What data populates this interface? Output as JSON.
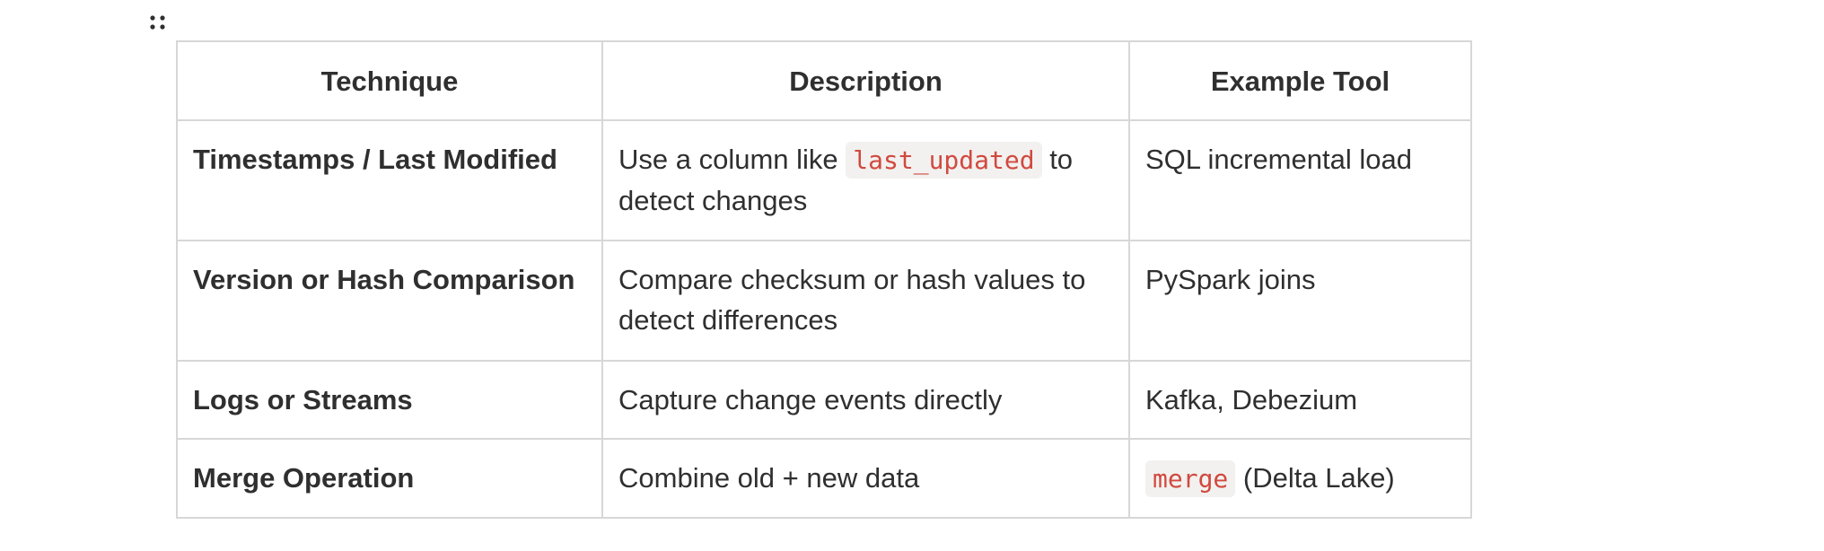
{
  "table": {
    "headers": [
      "Technique",
      "Description",
      "Example Tool"
    ],
    "rows": [
      {
        "technique": "Timestamps / Last Modified",
        "description": {
          "before": "Use a column like ",
          "code": "last_updated",
          "after": " to detect changes"
        },
        "tool": {
          "code": "",
          "text": "SQL incremental load"
        }
      },
      {
        "technique": "Version or Hash Comparison",
        "description": {
          "before": "Compare checksum or hash values to detect differences",
          "code": "",
          "after": ""
        },
        "tool": {
          "code": "",
          "text": "PySpark joins"
        }
      },
      {
        "technique": "Logs or Streams",
        "description": {
          "before": "Capture change events directly",
          "code": "",
          "after": ""
        },
        "tool": {
          "code": "",
          "text": "Kafka, Debezium"
        }
      },
      {
        "technique": "Merge Operation",
        "description": {
          "before": "Combine old + new data",
          "code": "",
          "after": ""
        },
        "tool": {
          "code": "merge",
          "text": " (Delta Lake)"
        }
      }
    ]
  },
  "colors": {
    "text": "#2f2f2f",
    "border": "#d7d7d7",
    "code_text": "#d1493f",
    "code_background": "#f2f1ef"
  },
  "icons": {
    "drag_handle": "drag-handle-icon"
  }
}
